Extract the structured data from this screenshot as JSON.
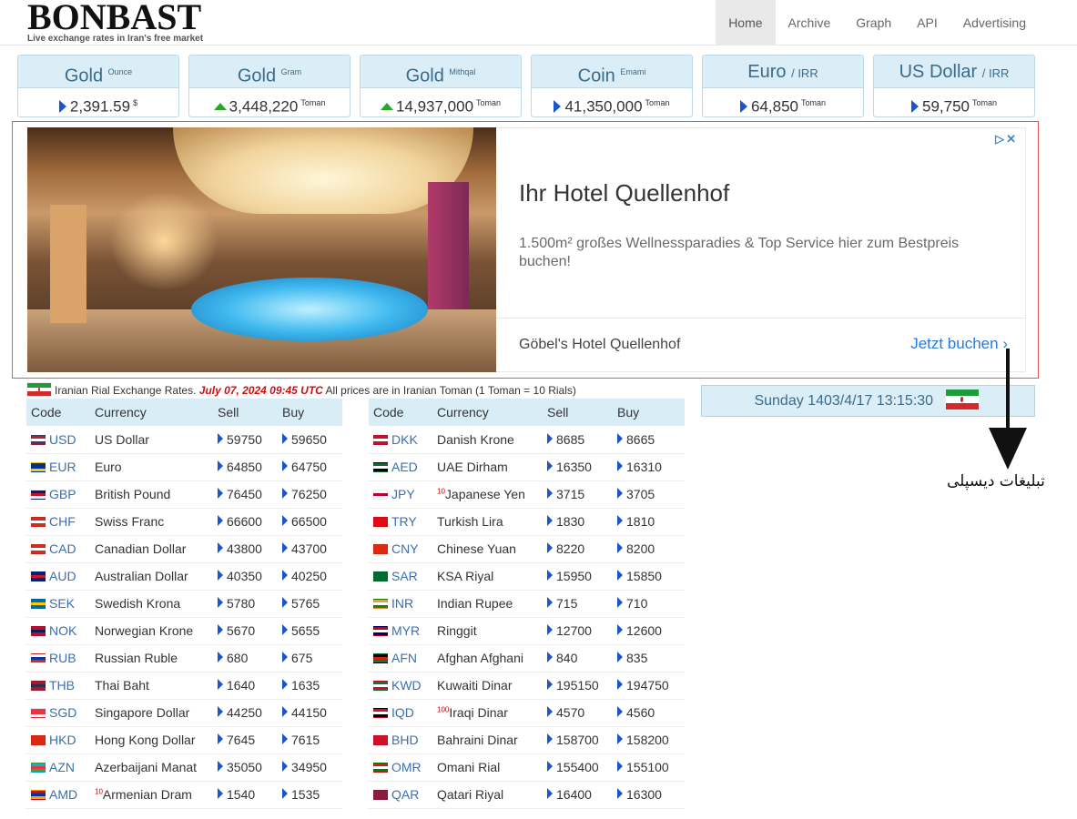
{
  "header": {
    "logo": "BONBAST",
    "tagline": "Live exchange rates in Iran's free market",
    "nav": [
      "Home",
      "Archive",
      "Graph",
      "API",
      "Advertising"
    ]
  },
  "cards": [
    {
      "name": "Gold",
      "sub": "Ounce",
      "value": "2,391.59",
      "unit": "$",
      "trend": "right"
    },
    {
      "name": "Gold",
      "sub": "Gram",
      "value": "3,448,220",
      "unit": "Toman",
      "trend": "up"
    },
    {
      "name": "Gold",
      "sub": "Mithqal",
      "value": "14,937,000",
      "unit": "Toman",
      "trend": "up"
    },
    {
      "name": "Coin",
      "sub": "Emami",
      "value": "41,350,000",
      "unit": "Toman",
      "trend": "right"
    },
    {
      "name": "Euro",
      "sub": "/ IRR",
      "value": "64,850",
      "unit": "Toman",
      "trend": "right"
    },
    {
      "name": "US Dollar",
      "sub": "/ IRR",
      "value": "59,750",
      "unit": "Toman",
      "trend": "right"
    }
  ],
  "ad": {
    "title": "Ihr Hotel Quellenhof",
    "description": "1.500m² großes Wellnessparadies & Top Service hier zum Bestpreis buchen!",
    "brand": "Göbel's Hotel Quellenhof",
    "cta": "Jetzt buchen",
    "choices": "▷✕"
  },
  "info": {
    "prefix": "Iranian Rial Exchange Rates.",
    "date": "July 07, 2024 09:45 UTC",
    "suffix": "All prices are in Iranian Toman (1 Toman = 10 Rials)"
  },
  "datebox": "Sunday 1403/4/17 13:15:30",
  "annotation": "تبلیغات دیسپلی",
  "table_headers": [
    "Code",
    "Currency",
    "Sell",
    "Buy"
  ],
  "table_left": [
    {
      "code": "USD",
      "currency": "US Dollar",
      "sell": "59750",
      "buy": "59650",
      "flag": [
        "#b22234",
        "#fff",
        "#3c3b6e"
      ],
      "pre": ""
    },
    {
      "code": "EUR",
      "currency": "Euro",
      "sell": "64850",
      "buy": "64750",
      "flag": [
        "#003399",
        "#003399",
        "#ffcc00"
      ],
      "pre": ""
    },
    {
      "code": "GBP",
      "currency": "British Pound",
      "sell": "76450",
      "buy": "76250",
      "flag": [
        "#012169",
        "#c8102e",
        "#fff"
      ],
      "pre": ""
    },
    {
      "code": "CHF",
      "currency": "Swiss Franc",
      "sell": "66600",
      "buy": "66500",
      "flag": [
        "#d52b1e",
        "#fff",
        "#d52b1e"
      ],
      "pre": ""
    },
    {
      "code": "CAD",
      "currency": "Canadian Dollar",
      "sell": "43800",
      "buy": "43700",
      "flag": [
        "#d52b1e",
        "#fff",
        "#d52b1e"
      ],
      "pre": ""
    },
    {
      "code": "AUD",
      "currency": "Australian Dollar",
      "sell": "40350",
      "buy": "40250",
      "flag": [
        "#00247d",
        "#cf142b",
        "#00247d"
      ],
      "pre": ""
    },
    {
      "code": "SEK",
      "currency": "Swedish Krona",
      "sell": "5780",
      "buy": "5765",
      "flag": [
        "#006aa7",
        "#fecc00",
        "#006aa7"
      ],
      "pre": ""
    },
    {
      "code": "NOK",
      "currency": "Norwegian Krone",
      "sell": "5670",
      "buy": "5655",
      "flag": [
        "#ba0c2f",
        "#00205b",
        "#ba0c2f"
      ],
      "pre": ""
    },
    {
      "code": "RUB",
      "currency": "Russian Ruble",
      "sell": "680",
      "buy": "675",
      "flag": [
        "#fff",
        "#0039a6",
        "#d52b1e"
      ],
      "pre": ""
    },
    {
      "code": "THB",
      "currency": "Thai Baht",
      "sell": "1640",
      "buy": "1635",
      "flag": [
        "#a51931",
        "#2d2a4a",
        "#a51931"
      ],
      "pre": ""
    },
    {
      "code": "SGD",
      "currency": "Singapore Dollar",
      "sell": "44250",
      "buy": "44150",
      "flag": [
        "#ef3340",
        "#ef3340",
        "#fff"
      ],
      "pre": ""
    },
    {
      "code": "HKD",
      "currency": "Hong Kong Dollar",
      "sell": "7645",
      "buy": "7615",
      "flag": [
        "#de2910",
        "#de2910",
        "#de2910"
      ],
      "pre": ""
    },
    {
      "code": "AZN",
      "currency": "Azerbaijani Manat",
      "sell": "35050",
      "buy": "34950",
      "flag": [
        "#00b5e2",
        "#ef3340",
        "#509e2f"
      ],
      "pre": ""
    },
    {
      "code": "AMD",
      "currency": "Armenian Dram",
      "sell": "1540",
      "buy": "1535",
      "flag": [
        "#d90012",
        "#0033a0",
        "#f2a800"
      ],
      "pre": "10"
    }
  ],
  "table_right": [
    {
      "code": "DKK",
      "currency": "Danish Krone",
      "sell": "8685",
      "buy": "8665",
      "flag": [
        "#c8102e",
        "#fff",
        "#c8102e"
      ],
      "pre": ""
    },
    {
      "code": "AED",
      "currency": "UAE Dirham",
      "sell": "16350",
      "buy": "16310",
      "flag": [
        "#00732f",
        "#fff",
        "#000"
      ],
      "pre": ""
    },
    {
      "code": "JPY",
      "currency": "Japanese Yen",
      "sell": "3715",
      "buy": "3705",
      "flag": [
        "#fff",
        "#bc002d",
        "#fff"
      ],
      "pre": "10"
    },
    {
      "code": "TRY",
      "currency": "Turkish Lira",
      "sell": "1830",
      "buy": "1810",
      "flag": [
        "#e30a17",
        "#e30a17",
        "#e30a17"
      ],
      "pre": ""
    },
    {
      "code": "CNY",
      "currency": "Chinese Yuan",
      "sell": "8220",
      "buy": "8200",
      "flag": [
        "#de2910",
        "#de2910",
        "#de2910"
      ],
      "pre": ""
    },
    {
      "code": "SAR",
      "currency": "KSA Riyal",
      "sell": "15950",
      "buy": "15850",
      "flag": [
        "#006c35",
        "#006c35",
        "#006c35"
      ],
      "pre": ""
    },
    {
      "code": "INR",
      "currency": "Indian Rupee",
      "sell": "715",
      "buy": "710",
      "flag": [
        "#ff9933",
        "#fff",
        "#138808"
      ],
      "pre": ""
    },
    {
      "code": "MYR",
      "currency": "Ringgit",
      "sell": "12700",
      "buy": "12600",
      "flag": [
        "#cc0001",
        "#fff",
        "#010066"
      ],
      "pre": ""
    },
    {
      "code": "AFN",
      "currency": "Afghan Afghani",
      "sell": "840",
      "buy": "835",
      "flag": [
        "#000",
        "#d32011",
        "#007a36"
      ],
      "pre": ""
    },
    {
      "code": "KWD",
      "currency": "Kuwaiti Dinar",
      "sell": "195150",
      "buy": "194750",
      "flag": [
        "#007a3d",
        "#fff",
        "#ce1126"
      ],
      "pre": ""
    },
    {
      "code": "IQD",
      "currency": "Iraqi Dinar",
      "sell": "4570",
      "buy": "4560",
      "flag": [
        "#ce1126",
        "#fff",
        "#000"
      ],
      "pre": "100"
    },
    {
      "code": "BHD",
      "currency": "Bahraini Dinar",
      "sell": "158700",
      "buy": "158200",
      "flag": [
        "#ce1126",
        "#ce1126",
        "#ce1126"
      ],
      "pre": ""
    },
    {
      "code": "OMR",
      "currency": "Omani Rial",
      "sell": "155400",
      "buy": "155100",
      "flag": [
        "#db161b",
        "#fff",
        "#008000"
      ],
      "pre": ""
    },
    {
      "code": "QAR",
      "currency": "Qatari Riyal",
      "sell": "16400",
      "buy": "16300",
      "flag": [
        "#8d1b3d",
        "#8d1b3d",
        "#8d1b3d"
      ],
      "pre": ""
    }
  ]
}
